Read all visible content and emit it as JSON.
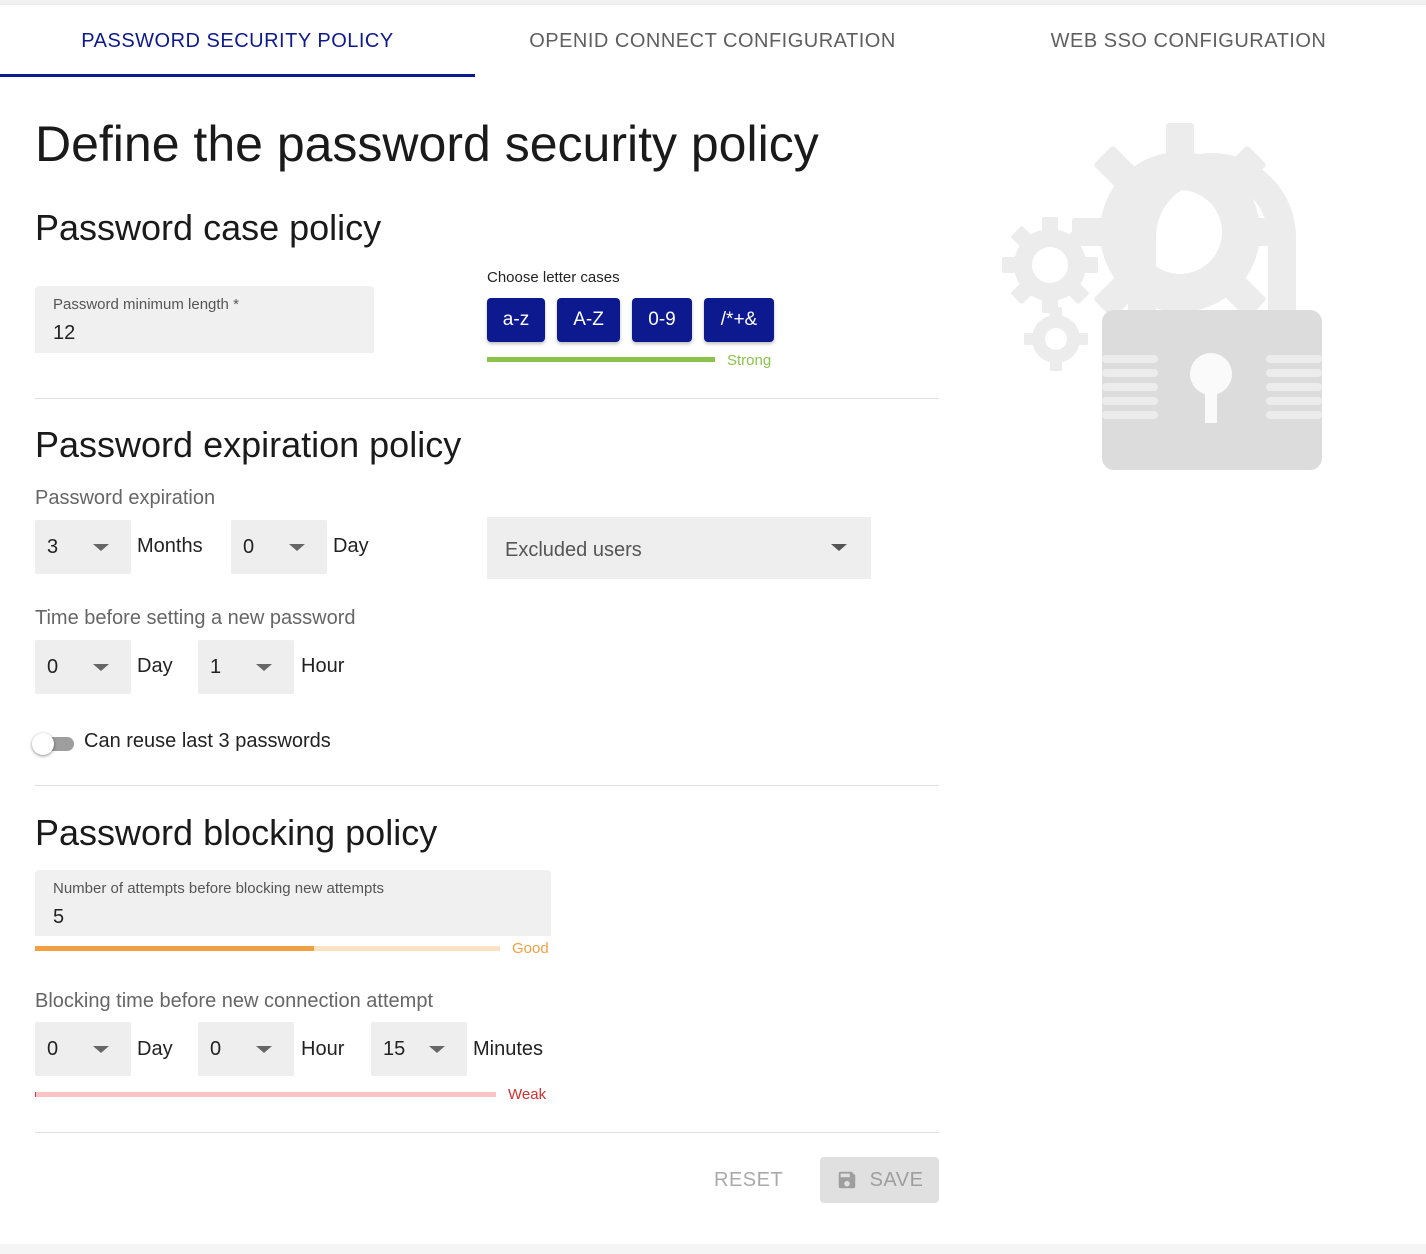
{
  "tabs": [
    {
      "label": "PASSWORD SECURITY POLICY"
    },
    {
      "label": "OPENID CONNECT CONFIGURATION"
    },
    {
      "label": "WEB SSO CONFIGURATION"
    }
  ],
  "page_title": "Define the password security policy",
  "case_policy": {
    "title": "Password case policy",
    "min_length_label": "Password minimum length *",
    "min_length_value": "12",
    "letter_cases_label": "Choose letter cases",
    "cases": [
      "a-z",
      "A-Z",
      "0-9",
      "/*+&"
    ],
    "strength_label": "Strong",
    "strength_fraction": 1.0
  },
  "expiration_policy": {
    "title": "Password expiration policy",
    "expiration_label": "Password expiration",
    "months_value": "3",
    "months_unit": "Months",
    "day_value": "0",
    "day_unit": "Day",
    "excluded_users_placeholder": "Excluded users",
    "new_password_label": "Time before setting a new password",
    "new_pw_day_value": "0",
    "new_pw_day_unit": "Day",
    "new_pw_hour_value": "1",
    "new_pw_hour_unit": "Hour",
    "reuse_label": "Can reuse last 3 passwords",
    "reuse_enabled": false
  },
  "blocking_policy": {
    "title": "Password blocking policy",
    "attempts_label": "Number of attempts before blocking new attempts",
    "attempts_value": "5",
    "attempts_strength_label": "Good",
    "attempts_strength_fraction": 0.6,
    "blocking_time_label": "Blocking time before new connection attempt",
    "block_day_value": "0",
    "block_day_unit": "Day",
    "block_hour_value": "0",
    "block_hour_unit": "Hour",
    "block_minutes_value": "15",
    "block_minutes_unit": "Minutes",
    "blocking_strength_label": "Weak",
    "blocking_strength_fraction": 0.0
  },
  "actions": {
    "reset_label": "RESET",
    "save_label": "SAVE"
  },
  "colors": {
    "primary": "#0d1a8f",
    "strong": "#8bc34a",
    "good": "#f0a040",
    "weak": "#e53935"
  }
}
